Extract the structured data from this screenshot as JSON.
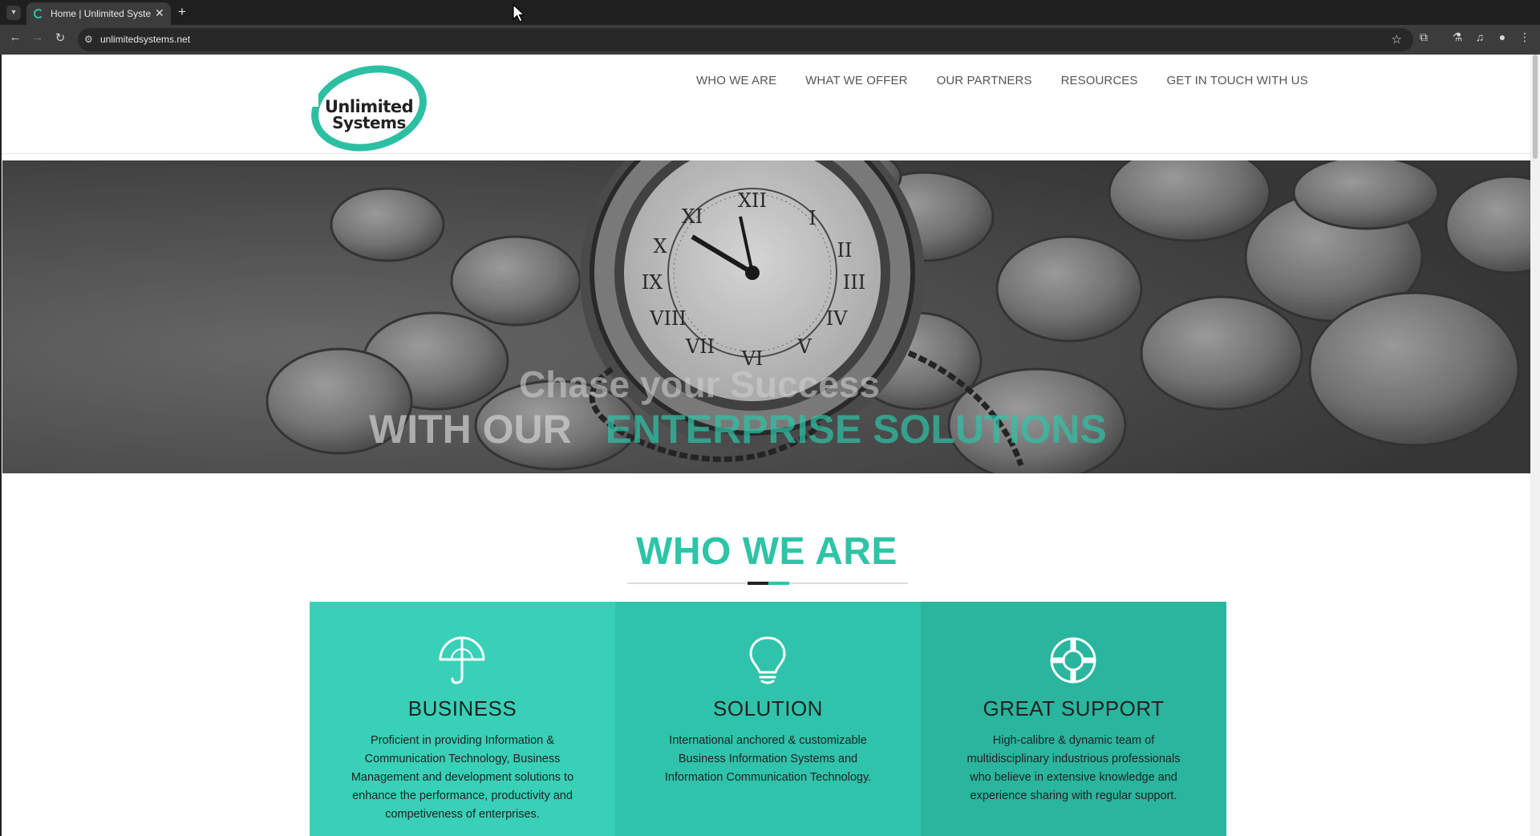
{
  "browser": {
    "tab_title": "Home | Unlimited Systems",
    "close_glyph": "✕",
    "new_tab_glyph": "+",
    "url": "unlimitedsystems.net",
    "icons": {
      "tab_dropdown": "chevron-down-icon",
      "back": "arrow-left-icon",
      "forward": "arrow-right-icon",
      "reload": "reload-icon",
      "site_info": "tune-icon",
      "bookmark": "star-icon",
      "extensions": "puzzle-icon",
      "labs": "flask-icon",
      "media": "queue-music-icon",
      "profile": "person-icon",
      "menu": "kebab-menu-icon"
    }
  },
  "site": {
    "logo_line1": "Unlimited",
    "logo_line2": "Systems",
    "nav": [
      "WHO WE ARE",
      "WHAT WE OFFER",
      "OUR PARTNERS",
      "RESOURCES",
      "GET IN TOUCH WITH US"
    ]
  },
  "hero": {
    "line1": "Chase your Success",
    "line2_part1": "WITH OUR",
    "line2_part2": "ENTERPRISE SOLUTIONS"
  },
  "section": {
    "title": "WHO WE ARE"
  },
  "features": [
    {
      "icon": "umbrella-icon",
      "title": "BUSINESS",
      "text": "Proficient in providing Information & Communication Technology, Business Management and development solutions to enhance the performance, productivity and competiveness of enterprises."
    },
    {
      "icon": "lightbulb-icon",
      "title": "SOLUTION",
      "text": "International anchored & customizable Business Information Systems and Information Communication Technology."
    },
    {
      "icon": "lifebuoy-icon",
      "title": "GREAT SUPPORT",
      "text": "High-calibre & dynamic team of multidisciplinary industrious professionals who believe in extensive knowledge and experience sharing with regular support."
    }
  ],
  "colors": {
    "accent": "#2dc4a7",
    "feature1": "#38d1b8",
    "feature2": "#30c3ab",
    "feature3": "#2ab59e"
  }
}
